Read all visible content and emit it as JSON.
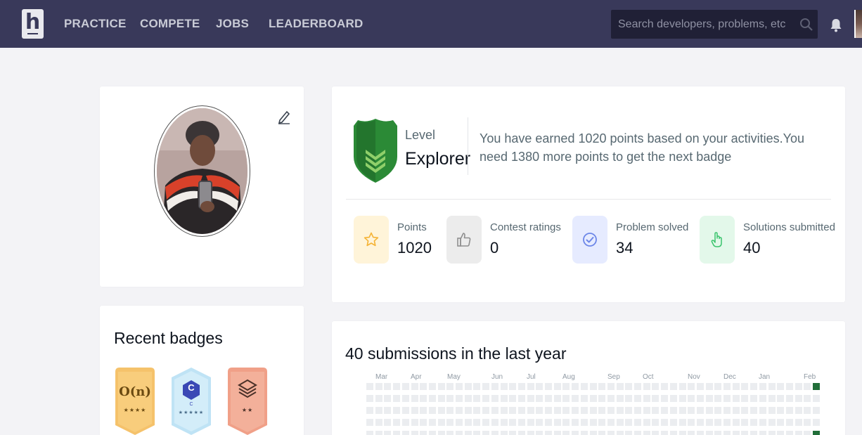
{
  "nav": {
    "logo_letter": "h",
    "links": [
      "PRACTICE",
      "COMPETE",
      "JOBS",
      "LEADERBOARD"
    ],
    "search_placeholder": "Search developers, problems, etc"
  },
  "badges": {
    "title": "Recent badges",
    "items": [
      {
        "label": "O(n)",
        "stars": "★★★★",
        "color": "#f5c26b"
      },
      {
        "label": "C",
        "sub": "C",
        "stars": "★★★★★",
        "color": "#cfe9f6"
      },
      {
        "label": "",
        "stars": "★★",
        "color": "#f0a088"
      }
    ]
  },
  "level": {
    "label": "Level",
    "name": "Explorer",
    "description": "You have earned 1020 points based on your activities.You need 1380 more points to get the next badge"
  },
  "stats": [
    {
      "label": "Points",
      "value": "1020",
      "icon": "star-icon",
      "bg": "#fff4d9"
    },
    {
      "label": "Contest ratings",
      "value": "0",
      "icon": "thumbs-up-icon",
      "bg": "#ececec"
    },
    {
      "label": "Problem solved",
      "value": "34",
      "icon": "check-circle-icon",
      "bg": "#e6ebff"
    },
    {
      "label": "Solutions submitted",
      "value": "40",
      "icon": "pointer-hand-icon",
      "bg": "#e3f8ea"
    }
  ],
  "submissions": {
    "title": "40 submissions in the last year",
    "months": [
      "Mar",
      "Apr",
      "May",
      "Jun",
      "Jul",
      "Aug",
      "Sep",
      "Oct",
      "Nov",
      "Dec",
      "Jan",
      "Feb"
    ]
  },
  "colors": {
    "nav_bg": "#39395a",
    "level_green": "#2b8a36",
    "activity_green": "#216e39"
  }
}
